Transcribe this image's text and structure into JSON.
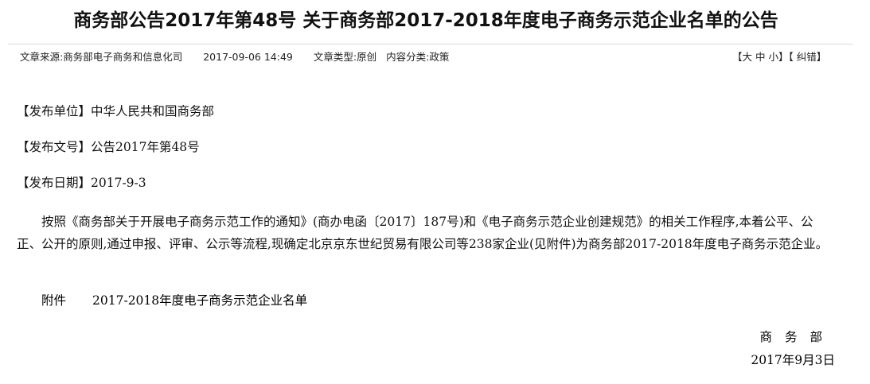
{
  "header": {
    "title": "商务部公告2017年第48号 关于商务部2017-2018年度电子商务示范企业名单的公告"
  },
  "meta": {
    "source_label": "文章来源:",
    "source_value": "商务部电子商务和信息化司",
    "datetime": "2017-09-06 14:49",
    "type_label": "文章类型:",
    "type_value": "原创",
    "category_label": "内容分类:",
    "category_value": "政策"
  },
  "font_controls": {
    "open": "【",
    "large": "大",
    "medium": "中",
    "small": "小",
    "close": "】",
    "correction": "【 纠错】"
  },
  "info": {
    "publisher": "【发布单位】中华人民共和国商务部",
    "doc_number": "【发布文号】公告2017年第48号",
    "pub_date": "【发布日期】2017-9-3"
  },
  "body": {
    "paragraph": "按照《商务部关于开展电子商务示范工作的通知》(商办电函〔2017〕187号)和《电子商务示范企业创建规范》的相关工作程序,本着公平、公正、公开的原则,通过申报、评审、公示等流程,现确定北京京东世纪贸易有限公司等238家企业(见附件)为商务部2017-2018年度电子商务示范企业。",
    "attachment_label": "附件",
    "attachment_link": "2017-2018年度电子商务示范企业名单"
  },
  "signature": {
    "org": "商务部",
    "date": "2017年9月3日"
  }
}
